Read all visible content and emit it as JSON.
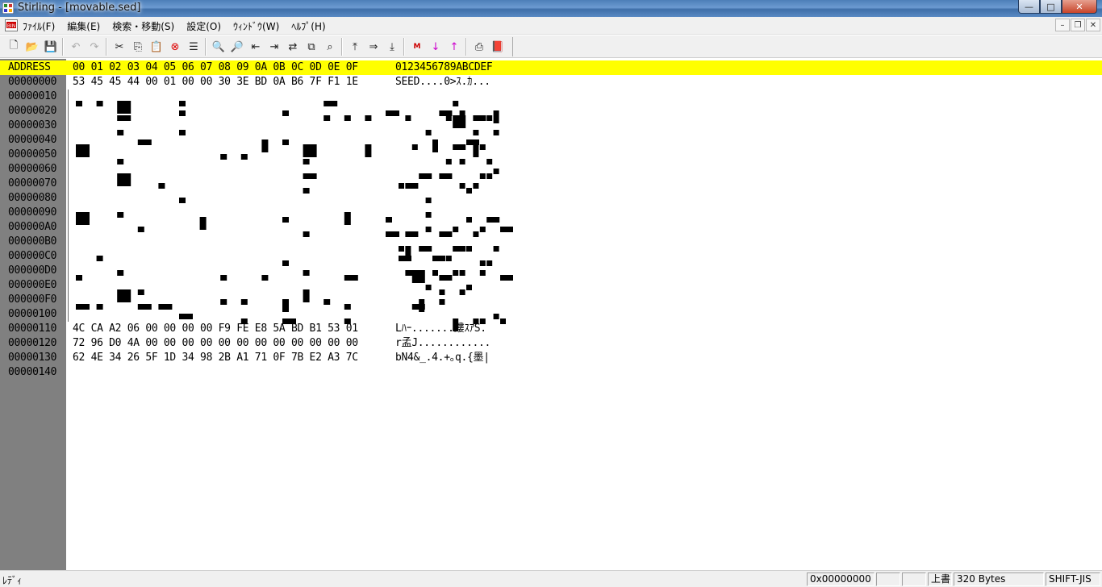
{
  "window": {
    "title": "Stirling - [movable.sed]",
    "buttons": {
      "minimize": "—",
      "maximize": "□",
      "close": "✕"
    }
  },
  "menu": {
    "items": [
      "ﾌｧｲﾙ(F)",
      "編集(E)",
      "検索・移動(S)",
      "設定(O)",
      "ｳｨﾝﾄﾞｳ(W)",
      "ﾍﾙﾌﾟ(H)"
    ],
    "mdi_buttons": {
      "minimize": "–",
      "restore": "❐",
      "close": "✕"
    }
  },
  "toolbar": {
    "buttons": [
      {
        "name": "new-file-icon",
        "glyph": "🗋"
      },
      {
        "name": "open-folder-icon",
        "glyph": "📂"
      },
      {
        "name": "save-icon",
        "glyph": "💾"
      },
      {
        "name": "undo-icon",
        "glyph": "↶"
      },
      {
        "name": "redo-icon",
        "glyph": "↷"
      },
      {
        "name": "cut-icon",
        "glyph": "✂"
      },
      {
        "name": "copy-icon",
        "glyph": "⎘"
      },
      {
        "name": "paste-icon",
        "glyph": "📋"
      },
      {
        "name": "delete-icon",
        "glyph": "⊗"
      },
      {
        "name": "list-icon",
        "glyph": "☰"
      },
      {
        "name": "find-icon",
        "glyph": "🔍"
      },
      {
        "name": "find-next-icon",
        "glyph": "🔎"
      },
      {
        "name": "find-prev-icon",
        "glyph": "⇤"
      },
      {
        "name": "find-down-icon",
        "glyph": "⇥"
      },
      {
        "name": "replace-icon",
        "glyph": "⇄"
      },
      {
        "name": "compare-icon",
        "glyph": "⧉"
      },
      {
        "name": "find-in-files-icon",
        "glyph": "⌕"
      },
      {
        "name": "goto-start-icon",
        "glyph": "⤒"
      },
      {
        "name": "goto-address-icon",
        "glyph": "⇒"
      },
      {
        "name": "goto-end-icon",
        "glyph": "⤓"
      },
      {
        "name": "mark-icon",
        "glyph": "M"
      },
      {
        "name": "mark-next-icon",
        "glyph": "↓"
      },
      {
        "name": "mark-prev-icon",
        "glyph": "↑"
      },
      {
        "name": "print-icon",
        "glyph": "⎙"
      },
      {
        "name": "help-book-icon",
        "glyph": "📕"
      }
    ]
  },
  "hex": {
    "header": {
      "address": "ADDRESS",
      "columns": "00 01 02 03 04 05 06 07 08 09 0A 0B 0C 0D 0E 0F",
      "ascii": "0123456789ABCDEF"
    },
    "rows": [
      {
        "addr": "00000000",
        "hex": "53 45 45 44 00 01 00 00 30 3E BD 0A B6 7F F1 1E",
        "ascii": "SEED....0>ｽ.ｶ..."
      },
      {
        "addr": "00000010",
        "hex": "",
        "ascii": ""
      },
      {
        "addr": "00000020",
        "hex": "",
        "ascii": ""
      },
      {
        "addr": "00000030",
        "hex": "",
        "ascii": ""
      },
      {
        "addr": "00000040",
        "hex": "",
        "ascii": ""
      },
      {
        "addr": "00000050",
        "hex": "",
        "ascii": ""
      },
      {
        "addr": "00000060",
        "hex": "",
        "ascii": ""
      },
      {
        "addr": "00000070",
        "hex": "",
        "ascii": ""
      },
      {
        "addr": "00000080",
        "hex": "",
        "ascii": ""
      },
      {
        "addr": "00000090",
        "hex": "",
        "ascii": ""
      },
      {
        "addr": "000000A0",
        "hex": "",
        "ascii": ""
      },
      {
        "addr": "000000B0",
        "hex": "",
        "ascii": ""
      },
      {
        "addr": "000000C0",
        "hex": "",
        "ascii": ""
      },
      {
        "addr": "000000D0",
        "hex": "",
        "ascii": ""
      },
      {
        "addr": "000000E0",
        "hex": "",
        "ascii": ""
      },
      {
        "addr": "000000F0",
        "hex": "",
        "ascii": ""
      },
      {
        "addr": "00000100",
        "hex": "",
        "ascii": ""
      },
      {
        "addr": "00000110",
        "hex": "4C CA A2 06 00 00 00 00 F9 FE E8 5A BD B1 53 01",
        "ascii": "Lﾊｰ.......鏤ｽｱS."
      },
      {
        "addr": "00000120",
        "hex": "72 96 D0 4A 00 00 00 00 00 00 00 00 00 00 00 00",
        "ascii": "r孟J............"
      },
      {
        "addr": "00000130",
        "hex": "62 4E 34 26 5F 1D 34 98 2B A1 71 0F 7B E2 A3 7C",
        "ascii": "bN4&_.4.+｡q.{墨|"
      },
      {
        "addr": "00000140",
        "hex": "",
        "ascii": ""
      }
    ]
  },
  "status": {
    "ready": "ﾚﾃﾞｨ",
    "address": "0x00000000",
    "blank1": "",
    "blank2": "",
    "mode": "上書",
    "size": "320 Bytes",
    "encoding": "SHIFT-JIS"
  },
  "colors": {
    "header_bg": "#ffff00",
    "address_col_bg": "#808080",
    "noise": "#000000"
  }
}
